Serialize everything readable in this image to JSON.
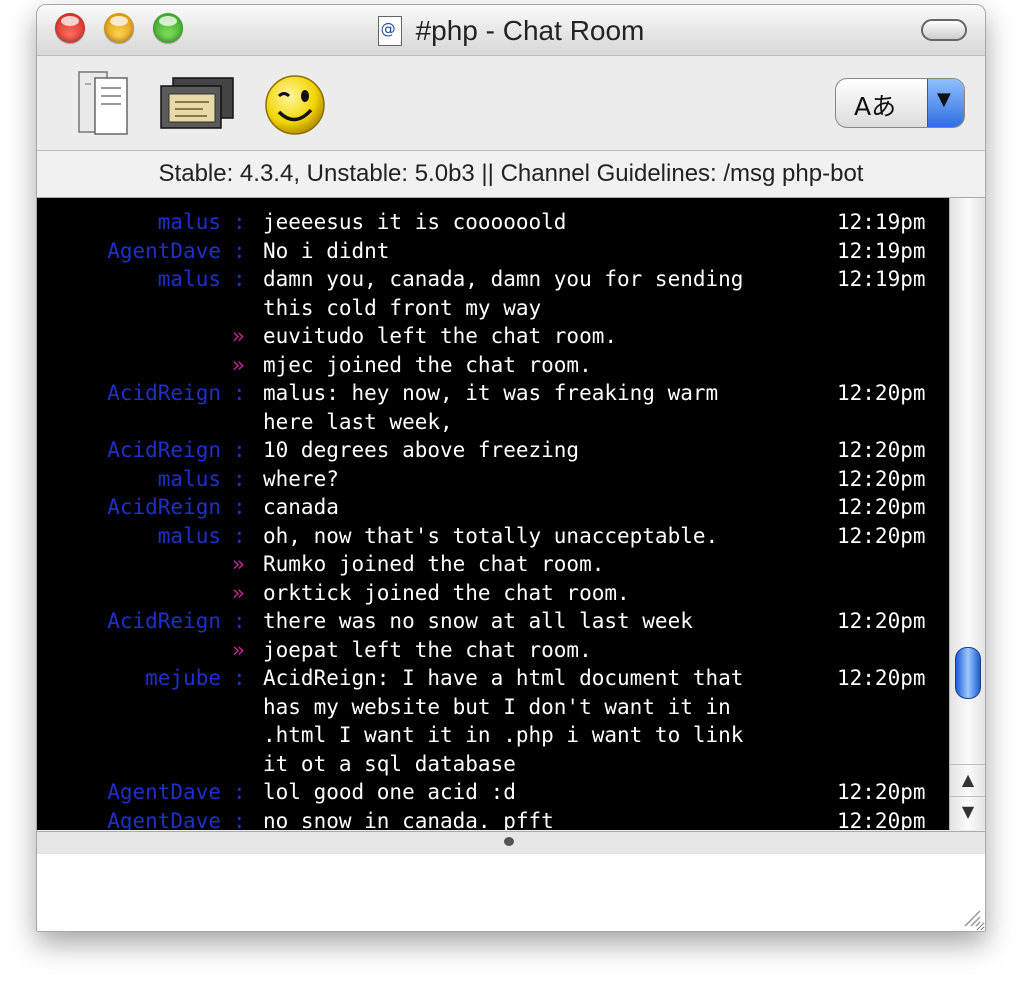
{
  "window": {
    "title": "#php - Chat Room"
  },
  "toolbar": {
    "language_label": "Aあ"
  },
  "topic": "Stable: 4.3.4, Unstable: 5.0b3 || Channel Guidelines: /msg php-bot",
  "messages": [
    {
      "nick": "malus",
      "text": "jeeeesus it is coooooold",
      "time": "12:19pm"
    },
    {
      "nick": "AgentDave",
      "text": "No i didnt",
      "time": "12:19pm"
    },
    {
      "nick": "malus",
      "text": "damn you, canada, damn you for sending",
      "time": "12:19pm"
    },
    {
      "text": "this cold front my way"
    },
    {
      "system": true,
      "text": "euvitudo left the chat room."
    },
    {
      "system": true,
      "text": "mjec joined the chat room."
    },
    {
      "nick": "AcidReign",
      "text": "malus: hey now, it was freaking warm",
      "time": "12:20pm"
    },
    {
      "text": "here last week,"
    },
    {
      "nick": "AcidReign",
      "text": "10 degrees above freezing",
      "time": "12:20pm"
    },
    {
      "nick": "malus",
      "text": "where?",
      "time": "12:20pm"
    },
    {
      "nick": "AcidReign",
      "text": "canada",
      "time": "12:20pm"
    },
    {
      "nick": "malus",
      "text": "oh, now that's totally unacceptable.",
      "time": "12:20pm"
    },
    {
      "system": true,
      "text": "Rumko joined the chat room."
    },
    {
      "system": true,
      "text": "orktick joined the chat room."
    },
    {
      "nick": "AcidReign",
      "text": "there was no snow at all last week",
      "time": "12:20pm"
    },
    {
      "system": true,
      "text": "joepat left the chat room."
    },
    {
      "nick": "mejube",
      "text": "AcidReign: I have a html document that",
      "time": "12:20pm"
    },
    {
      "text": "has my website but I don't want it in"
    },
    {
      "text": ".html I want it in .php i want to link"
    },
    {
      "text": "it ot a sql database"
    },
    {
      "nick": "AgentDave",
      "text": "lol good one acid :d",
      "time": "12:20pm"
    },
    {
      "nick": "AgentDave",
      "text": "no snow in canada. pfft",
      "time": "12:20pm"
    }
  ],
  "symbols": {
    "colon": ":",
    "arrow": "»",
    "scroll_up": "▲",
    "scroll_down": "▼",
    "dropdown": "▼",
    "doc_glyph": "@"
  },
  "scroll": {
    "position_fraction": 0.88
  },
  "colors": {
    "nick": "#1f30c8",
    "system_arrow": "#c02690",
    "chat_bg": "#000000",
    "text": "#ffffff"
  }
}
